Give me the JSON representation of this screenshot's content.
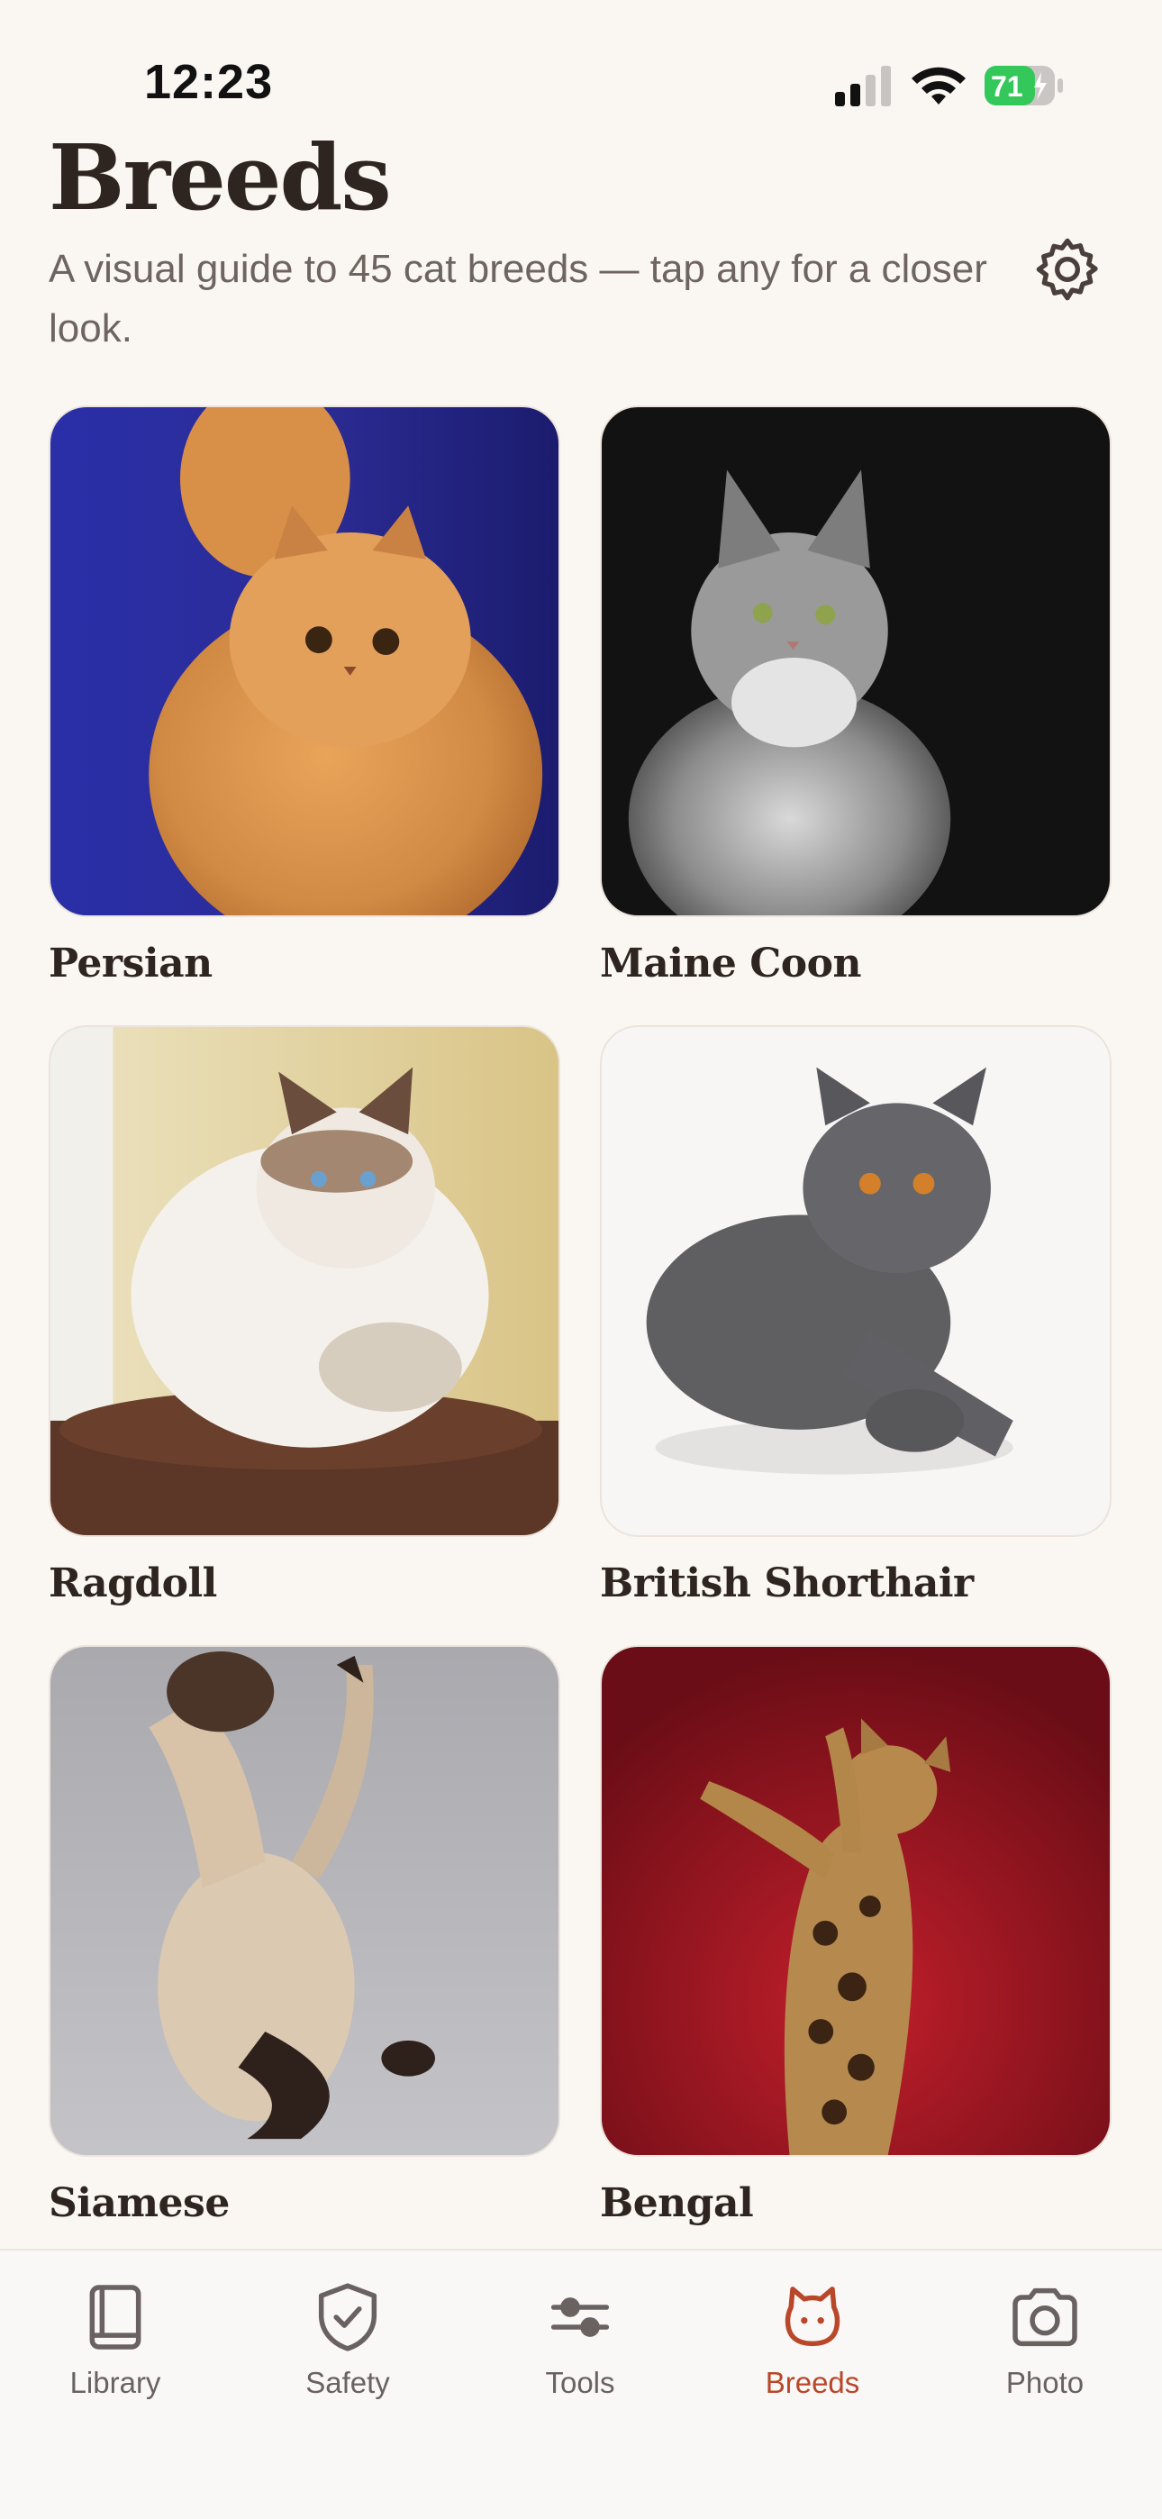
{
  "status_bar": {
    "time": "12:23",
    "battery": "71"
  },
  "header": {
    "title": "Breeds",
    "subtitle": "A visual guide to 45 cat breeds — tap any for a closer look."
  },
  "breeds": [
    {
      "name": "Persian"
    },
    {
      "name": "Maine Coon"
    },
    {
      "name": "Ragdoll"
    },
    {
      "name": "British Shorthair"
    },
    {
      "name": "Siamese"
    },
    {
      "name": "Bengal"
    }
  ],
  "tabs": [
    {
      "label": "Library",
      "icon": "book-icon"
    },
    {
      "label": "Safety",
      "icon": "shield-check-icon"
    },
    {
      "label": "Tools",
      "icon": "sliders-icon"
    },
    {
      "label": "Breeds",
      "icon": "cat-face-icon",
      "active": true
    },
    {
      "label": "Photo",
      "icon": "camera-icon"
    }
  ],
  "colors": {
    "background": "#faf7f3",
    "text": "#2f2520",
    "accent": "#b9472a",
    "battery": "#34c759"
  }
}
